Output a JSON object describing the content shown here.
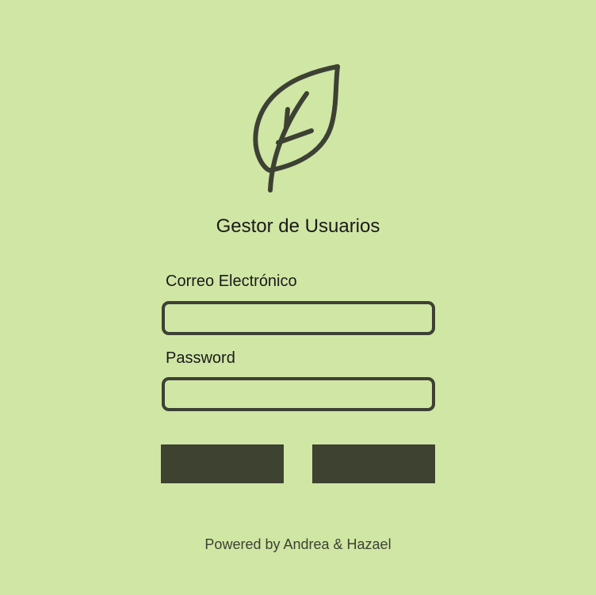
{
  "app": {
    "title": "Gestor de Usuarios",
    "logo_icon": "leaf-icon"
  },
  "form": {
    "email_label": "Correo Electrónico",
    "email_value": "",
    "password_label": "Password",
    "password_value": "",
    "login_button_label": "",
    "register_button_label": ""
  },
  "footer": {
    "text": "Powered by Andrea & Hazael"
  },
  "colors": {
    "background": "#d0e6a5",
    "accent": "#3d4231"
  }
}
